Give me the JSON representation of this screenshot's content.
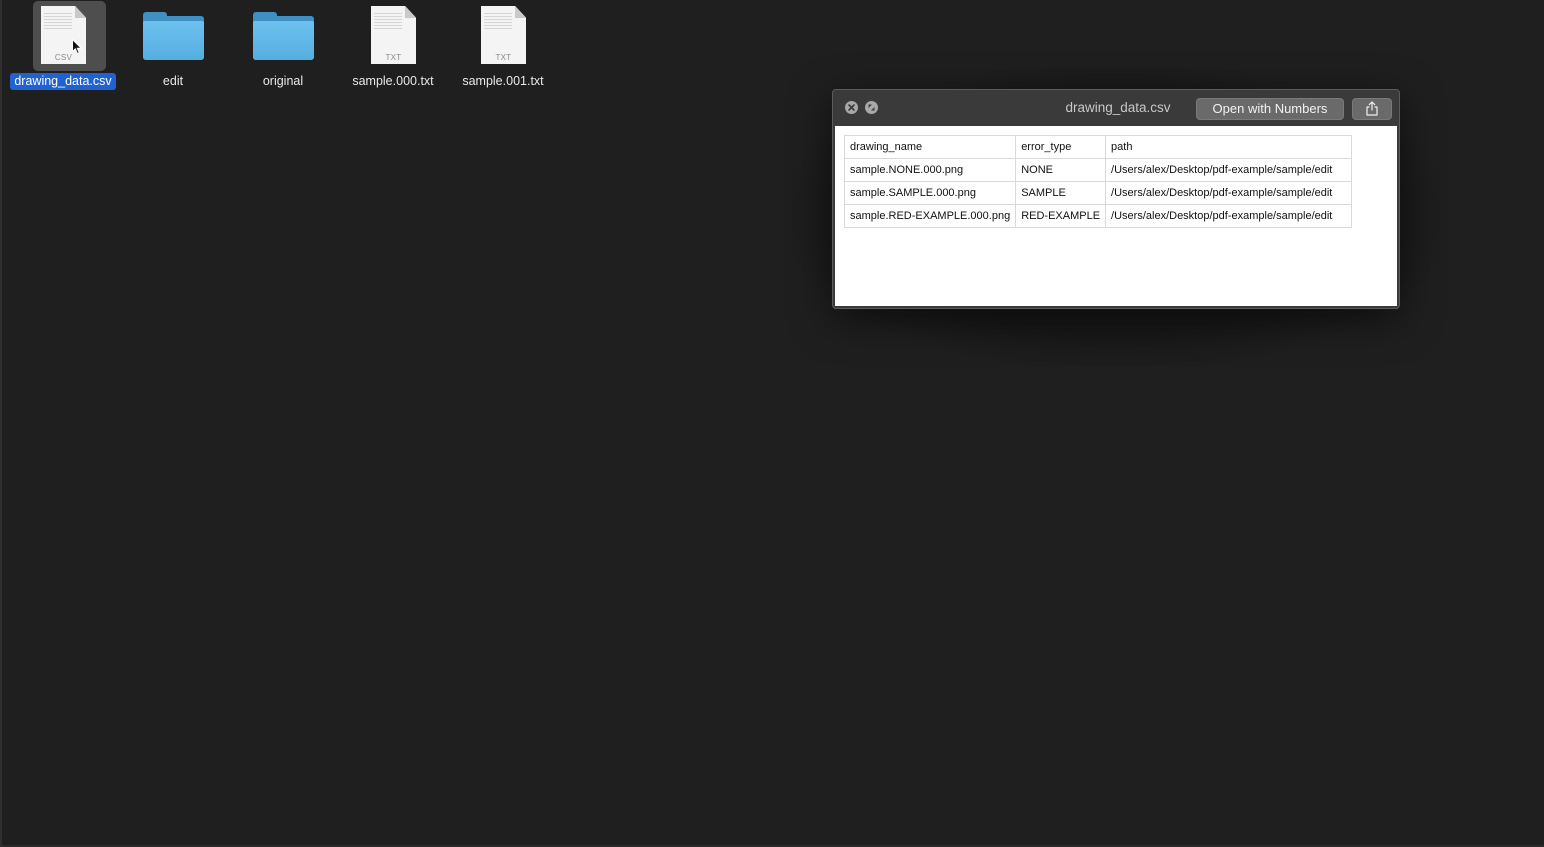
{
  "desktop": {
    "icons": [
      {
        "label": "drawing_data.csv",
        "type": "document",
        "ext": "CSV",
        "selected": true
      },
      {
        "label": "edit",
        "type": "folder",
        "selected": false
      },
      {
        "label": "original",
        "type": "folder",
        "selected": false
      },
      {
        "label": "sample.000.txt",
        "type": "document",
        "ext": "TXT",
        "selected": false
      },
      {
        "label": "sample.001.txt",
        "type": "document",
        "ext": "TXT",
        "selected": false
      }
    ]
  },
  "quicklook": {
    "title": "drawing_data.csv",
    "open_button_label": "Open with Numbers",
    "share_icon": "share-icon",
    "close_icon": "close-icon",
    "fullscreen_icon": "fullscreen-icon",
    "table": {
      "headers": [
        "drawing_name",
        "error_type",
        "path"
      ],
      "rows": [
        [
          "sample.NONE.000.png",
          "NONE",
          "/Users/alex/Desktop/pdf-example/sample/edit"
        ],
        [
          "sample.SAMPLE.000.png",
          "SAMPLE",
          "/Users/alex/Desktop/pdf-example/sample/edit"
        ],
        [
          "sample.RED-EXAMPLE.000.png",
          "RED-EXAMPLE",
          "/Users/alex/Desktop/pdf-example/sample/edit"
        ]
      ]
    }
  },
  "colors": {
    "desktop_bg": "#1f1f1f",
    "selection_blue": "#2062d1",
    "folder_blue": "#56aee0"
  }
}
